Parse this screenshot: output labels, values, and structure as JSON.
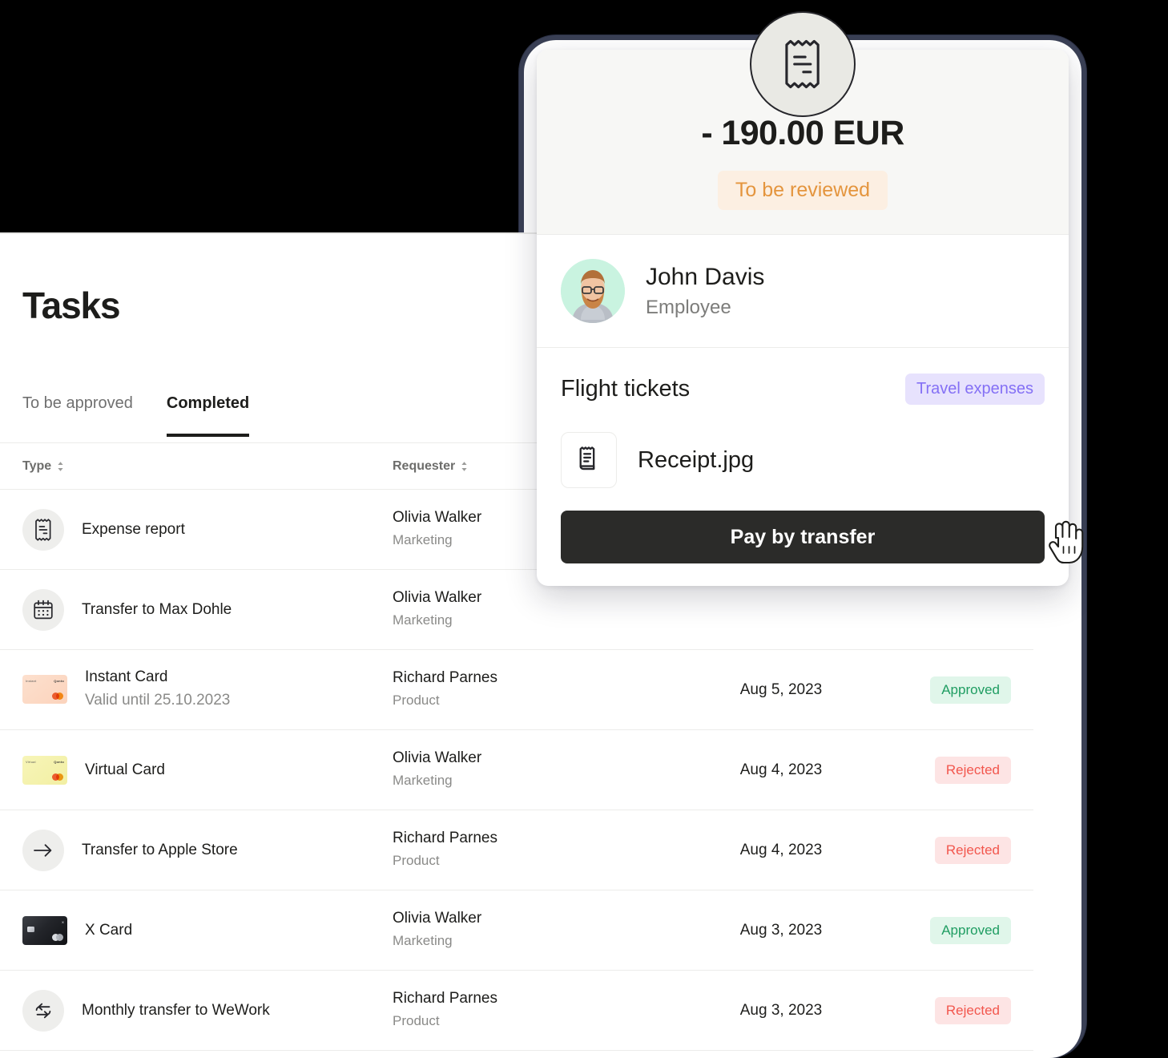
{
  "page": {
    "title": "Tasks"
  },
  "tabs": [
    {
      "label": "To be approved",
      "active": false
    },
    {
      "label": "Completed",
      "active": true
    }
  ],
  "table": {
    "columns": [
      {
        "label": "Type",
        "sortable": true
      },
      {
        "label": "Requester",
        "sortable": true
      }
    ],
    "rows": [
      {
        "icon": "receipt-icon",
        "type": "Expense report",
        "subtitle": "",
        "requester": "Olivia Walker",
        "team": "Marketing",
        "date": "",
        "status": ""
      },
      {
        "icon": "calendar-icon",
        "type": "Transfer to Max Dohle",
        "subtitle": "",
        "requester": "Olivia Walker",
        "team": "Marketing",
        "date": "",
        "status": ""
      },
      {
        "icon": "instant-card-thumbnail",
        "card_left_label": "Instant",
        "card_right_label": "Qonto",
        "type": "Instant Card",
        "subtitle": "Valid until 25.10.2023",
        "requester": "Richard Parnes",
        "team": "Product",
        "date": "Aug 5, 2023",
        "status": "Approved"
      },
      {
        "icon": "virtual-card-thumbnail",
        "card_left_label": "Virtual",
        "card_right_label": "Qonto",
        "type": "Virtual Card",
        "subtitle": "",
        "requester": "Olivia Walker",
        "team": "Marketing",
        "date": "Aug 4, 2023",
        "status": "Rejected"
      },
      {
        "icon": "arrow-right-icon",
        "type": "Transfer to Apple Store",
        "subtitle": "",
        "requester": "Richard Parnes",
        "team": "Product",
        "date": "Aug 4, 2023",
        "status": "Rejected"
      },
      {
        "icon": "x-card-thumbnail",
        "card_left_label": "",
        "card_right_label": "X",
        "type": "X Card",
        "subtitle": "",
        "requester": "Olivia Walker",
        "team": "Marketing",
        "date": "Aug 3, 2023",
        "status": "Approved"
      },
      {
        "icon": "recurring-transfer-icon",
        "type": "Monthly transfer to WeWork",
        "subtitle": "",
        "requester": "Richard Parnes",
        "team": "Product",
        "date": "Aug 3, 2023",
        "status": "Rejected"
      }
    ]
  },
  "popup": {
    "header_icon": "receipt-icon",
    "amount": "- 190.00 EUR",
    "status": "To be reviewed",
    "person": {
      "name": "John Davis",
      "role": "Employee",
      "avatar": "employee-avatar"
    },
    "expense_title": "Flight tickets",
    "category_tag": "Travel expenses",
    "attachment": {
      "icon": "document-icon",
      "name": "Receipt.jpg"
    },
    "primary_action": "Pay by transfer",
    "cursor": "pointing-hand-cursor"
  },
  "colors": {
    "status_pending_bg": "#fcefe2",
    "status_pending_text": "#e4953e",
    "tag_bg": "#e7e2fd",
    "tag_text": "#8470f5",
    "approved_bg": "#e0f6ea",
    "approved_text": "#1f9d62",
    "rejected_bg": "#fde4e4",
    "rejected_text": "#f2564d",
    "primary_button": "#2b2b29"
  }
}
